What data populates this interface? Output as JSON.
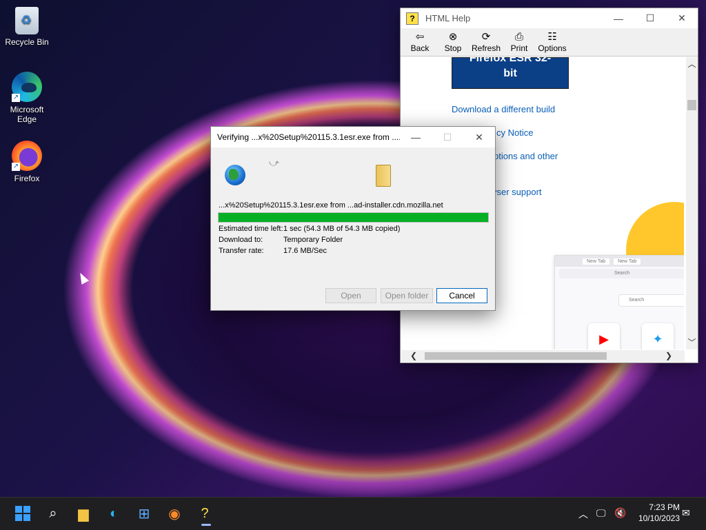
{
  "desktop": {
    "icons": [
      {
        "label": "Recycle Bin"
      },
      {
        "label": "Microsoft Edge"
      },
      {
        "label": "Firefox"
      }
    ]
  },
  "help_window": {
    "title": "HTML Help",
    "toolbar": [
      {
        "label": "Back",
        "icon": "back-arrow-icon"
      },
      {
        "label": "Stop",
        "icon": "stop-icon"
      },
      {
        "label": "Refresh",
        "icon": "refresh-icon"
      },
      {
        "label": "Print",
        "icon": "printer-icon"
      },
      {
        "label": "Options",
        "icon": "options-icon"
      }
    ],
    "content": {
      "banner_line1": "Firefox ESR 32-",
      "banner_line2": "bit",
      "links": [
        "Download a different build",
        "cy Notice",
        "ptions and other",
        "vser support"
      ],
      "preview": {
        "tab1": "New Tab",
        "tab2": "New Tab",
        "url_text": "Search",
        "search_text": "Search"
      }
    }
  },
  "download_dialog": {
    "title": "Verifying ...x%20Setup%20115.3.1esr.exe from ......",
    "source": "...x%20Setup%20115.3.1esr.exe from ...ad-installer.cdn.mozilla.net",
    "progress_percent": 100,
    "rows": [
      {
        "key": "Estimated time left:",
        "value": "1 sec (54.3 MB of 54.3 MB copied)"
      },
      {
        "key": "Download to:",
        "value": "Temporary Folder"
      },
      {
        "key": "Transfer rate:",
        "value": "17.6 MB/Sec"
      }
    ],
    "buttons": {
      "open": "Open",
      "open_folder": "Open folder",
      "cancel": "Cancel"
    }
  },
  "taskbar": {
    "clock_time": "7:23 PM",
    "clock_date": "10/10/2023"
  }
}
